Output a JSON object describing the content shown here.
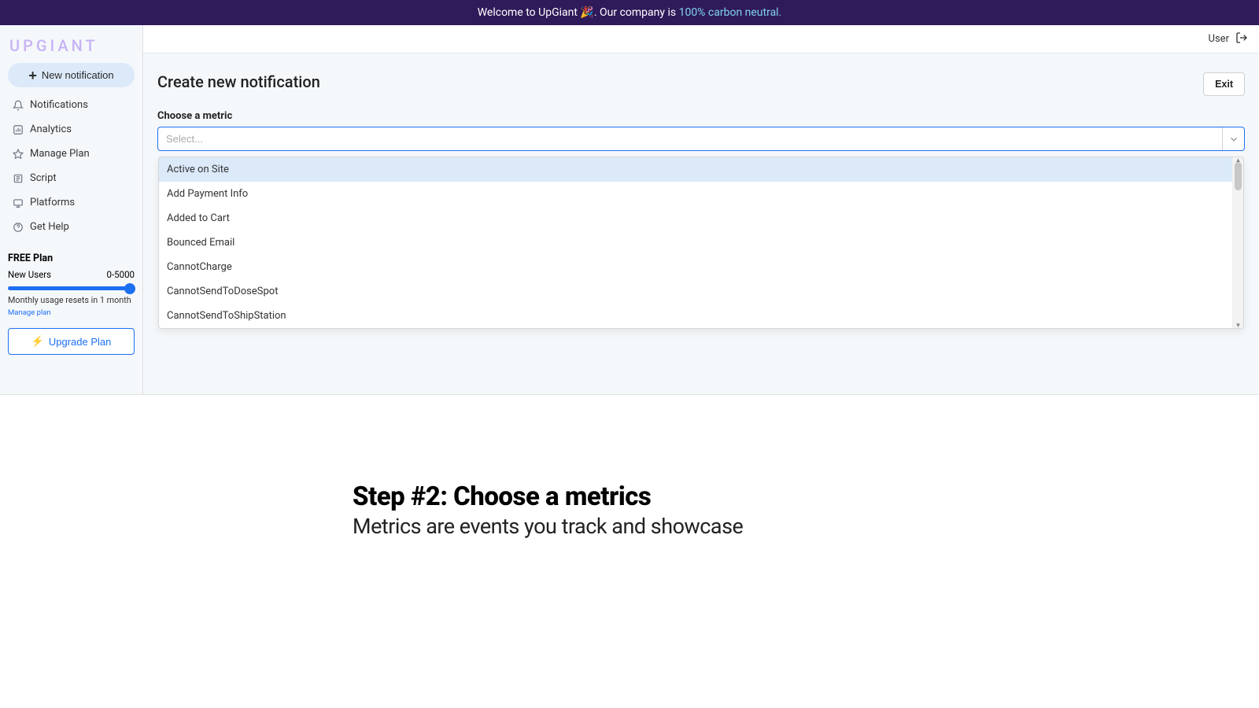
{
  "banner": {
    "welcome": "Welcome to UpGiant 🎉. Our company is ",
    "link": "100% carbon neutral.",
    "logo": "UPGIANT"
  },
  "sidebar": {
    "new_notification": "New notification",
    "items": [
      {
        "icon": "bell-icon",
        "label": "Notifications"
      },
      {
        "icon": "chart-icon",
        "label": "Analytics"
      },
      {
        "icon": "star-icon",
        "label": "Manage Plan"
      },
      {
        "icon": "script-icon",
        "label": "Script"
      },
      {
        "icon": "platforms-icon",
        "label": "Platforms"
      },
      {
        "icon": "help-icon",
        "label": "Get Help"
      }
    ],
    "plan": {
      "title": "FREE Plan",
      "metric_label": "New Users",
      "metric_value": "0-5000",
      "reset": "Monthly usage resets in 1 month",
      "manage_link": "Manage plan",
      "upgrade": "Upgrade Plan"
    }
  },
  "topbar": {
    "user": "User"
  },
  "page": {
    "title": "Create new notification",
    "exit": "Exit",
    "metric_label": "Choose a metric",
    "select_placeholder": "Select...",
    "options": [
      "Active on Site",
      "Add Payment Info",
      "Added to Cart",
      "Bounced Email",
      "CannotCharge",
      "CannotSendToDoseSpot",
      "CannotSendToShipStation"
    ]
  },
  "marketing": {
    "heading": "Step #2: Choose a metrics",
    "sub": "Metrics are events you track and showcase"
  }
}
